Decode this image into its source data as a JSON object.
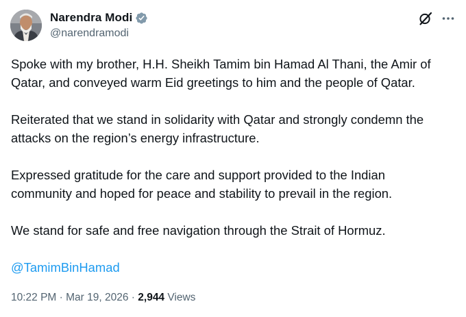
{
  "author": {
    "name": "Narendra Modi",
    "handle": "@narendramodi",
    "verified": true,
    "verified_color": "#829aab"
  },
  "icons": {
    "avatar": "profile-photo",
    "verified": "verified-badge-icon",
    "grok": "grok-icon",
    "more": "more-options-icon"
  },
  "tweet": {
    "paragraphs": [
      "Spoke with my brother, H.H. Sheikh Tamim bin Hamad Al Thani, the Amir of\nQatar, and conveyed warm Eid greetings to him and the people of Qatar.",
      "Reiterated that we stand in solidarity with Qatar and strongly condemn the\nattacks on the region’s energy infrastructure.",
      "Expressed gratitude for the care and support provided to the Indian\ncommunity and hoped for peace and stability to prevail in the region.",
      "We stand for safe and free navigation through the Strait of Hormuz."
    ],
    "mention": "@TamimBinHamad"
  },
  "meta": {
    "time": "10:22 PM",
    "separator": " · ",
    "date": "Mar 19, 2026",
    "views_count": "2,944",
    "views_label": " Views"
  },
  "colors": {
    "text": "#0f1419",
    "secondary": "#536471",
    "link": "#1d9bf0"
  }
}
